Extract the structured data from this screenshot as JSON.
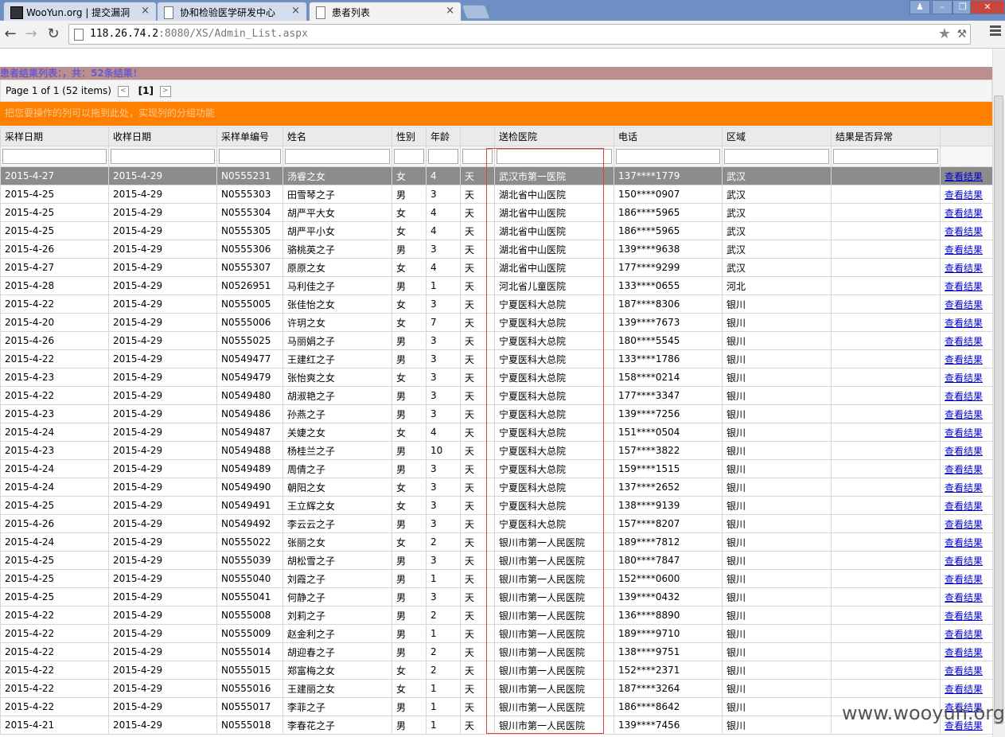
{
  "browser": {
    "tabs": [
      {
        "label": "WooYun.org | 提交漏洞",
        "active": false
      },
      {
        "label": "协和检验医学研发中心",
        "active": false
      },
      {
        "label": "患者列表",
        "active": true
      }
    ],
    "url_host": "118.26.74.2",
    "url_rest": ":8080/XS/Admin_List.aspx"
  },
  "page": {
    "caption": "患者结果列表：，共：52条结果！",
    "pager": {
      "text": "Page 1 of 1 (52 items)",
      "prev": "<",
      "current": "[1]",
      "next": ">"
    },
    "notice": "把您要操作的列可以拖到此处，实现列的分组功能",
    "columns": [
      "采样日期",
      "收样日期",
      "采样单编号",
      "姓名",
      "性别",
      "年龄",
      "",
      "送检医院",
      "电话",
      "区域",
      "结果是否异常",
      ""
    ],
    "rows": [
      [
        "2015-4-27",
        "2015-4-29",
        "N0555231",
        "汤睿之女",
        "女",
        "4",
        "天",
        "武汉市第一医院",
        "137****1779",
        "武汉",
        "",
        "查看结果"
      ],
      [
        "2015-4-25",
        "2015-4-29",
        "N0555303",
        "田雪琴之子",
        "男",
        "3",
        "天",
        "湖北省中山医院",
        "150****0907",
        "武汉",
        "",
        "查看结果"
      ],
      [
        "2015-4-25",
        "2015-4-29",
        "N0555304",
        "胡严平大女",
        "女",
        "4",
        "天",
        "湖北省中山医院",
        "186****5965",
        "武汉",
        "",
        "查看结果"
      ],
      [
        "2015-4-25",
        "2015-4-29",
        "N0555305",
        "胡严平小女",
        "女",
        "4",
        "天",
        "湖北省中山医院",
        "186****5965",
        "武汉",
        "",
        "查看结果"
      ],
      [
        "2015-4-26",
        "2015-4-29",
        "N0555306",
        "骆桃英之子",
        "男",
        "3",
        "天",
        "湖北省中山医院",
        "139****9638",
        "武汉",
        "",
        "查看结果"
      ],
      [
        "2015-4-27",
        "2015-4-29",
        "N0555307",
        "原原之女",
        "女",
        "4",
        "天",
        "湖北省中山医院",
        "177****9299",
        "武汉",
        "",
        "查看结果"
      ],
      [
        "2015-4-28",
        "2015-4-29",
        "N0526951",
        "马利佳之子",
        "男",
        "1",
        "天",
        "河北省儿童医院",
        "133****0655",
        "河北",
        "",
        "查看结果"
      ],
      [
        "2015-4-22",
        "2015-4-29",
        "N0555005",
        "张佳怡之女",
        "女",
        "3",
        "天",
        "宁夏医科大总院",
        "187****8306",
        "银川",
        "",
        "查看结果"
      ],
      [
        "2015-4-20",
        "2015-4-29",
        "N0555006",
        "许玥之女",
        "女",
        "7",
        "天",
        "宁夏医科大总院",
        "139****7673",
        "银川",
        "",
        "查看结果"
      ],
      [
        "2015-4-26",
        "2015-4-29",
        "N0555025",
        "马丽娟之子",
        "男",
        "3",
        "天",
        "宁夏医科大总院",
        "180****5545",
        "银川",
        "",
        "查看结果"
      ],
      [
        "2015-4-22",
        "2015-4-29",
        "N0549477",
        "王建红之子",
        "男",
        "3",
        "天",
        "宁夏医科大总院",
        "133****1786",
        "银川",
        "",
        "查看结果"
      ],
      [
        "2015-4-23",
        "2015-4-29",
        "N0549479",
        "张怡爽之女",
        "女",
        "3",
        "天",
        "宁夏医科大总院",
        "158****0214",
        "银川",
        "",
        "查看结果"
      ],
      [
        "2015-4-22",
        "2015-4-29",
        "N0549480",
        "胡淑艳之子",
        "男",
        "3",
        "天",
        "宁夏医科大总院",
        "177****3347",
        "银川",
        "",
        "查看结果"
      ],
      [
        "2015-4-23",
        "2015-4-29",
        "N0549486",
        "孙燕之子",
        "男",
        "3",
        "天",
        "宁夏医科大总院",
        "139****7256",
        "银川",
        "",
        "查看结果"
      ],
      [
        "2015-4-24",
        "2015-4-29",
        "N0549487",
        "关婕之女",
        "女",
        "4",
        "天",
        "宁夏医科大总院",
        "151****0504",
        "银川",
        "",
        "查看结果"
      ],
      [
        "2015-4-23",
        "2015-4-29",
        "N0549488",
        "杨桂兰之子",
        "男",
        "10",
        "天",
        "宁夏医科大总院",
        "157****3822",
        "银川",
        "",
        "查看结果"
      ],
      [
        "2015-4-24",
        "2015-4-29",
        "N0549489",
        "周倩之子",
        "男",
        "3",
        "天",
        "宁夏医科大总院",
        "159****1515",
        "银川",
        "",
        "查看结果"
      ],
      [
        "2015-4-24",
        "2015-4-29",
        "N0549490",
        "朝阳之女",
        "女",
        "3",
        "天",
        "宁夏医科大总院",
        "137****2652",
        "银川",
        "",
        "查看结果"
      ],
      [
        "2015-4-25",
        "2015-4-29",
        "N0549491",
        "王立辉之女",
        "女",
        "3",
        "天",
        "宁夏医科大总院",
        "138****9139",
        "银川",
        "",
        "查看结果"
      ],
      [
        "2015-4-26",
        "2015-4-29",
        "N0549492",
        "李云云之子",
        "男",
        "3",
        "天",
        "宁夏医科大总院",
        "157****8207",
        "银川",
        "",
        "查看结果"
      ],
      [
        "2015-4-24",
        "2015-4-29",
        "N0555022",
        "张丽之女",
        "女",
        "2",
        "天",
        "银川市第一人民医院",
        "189****7812",
        "银川",
        "",
        "查看结果"
      ],
      [
        "2015-4-25",
        "2015-4-29",
        "N0555039",
        "胡松雪之子",
        "男",
        "3",
        "天",
        "银川市第一人民医院",
        "180****7847",
        "银川",
        "",
        "查看结果"
      ],
      [
        "2015-4-25",
        "2015-4-29",
        "N0555040",
        "刘霞之子",
        "男",
        "1",
        "天",
        "银川市第一人民医院",
        "152****0600",
        "银川",
        "",
        "查看结果"
      ],
      [
        "2015-4-25",
        "2015-4-29",
        "N0555041",
        "何静之子",
        "男",
        "3",
        "天",
        "银川市第一人民医院",
        "139****0432",
        "银川",
        "",
        "查看结果"
      ],
      [
        "2015-4-22",
        "2015-4-29",
        "N0555008",
        "刘莉之子",
        "男",
        "2",
        "天",
        "银川市第一人民医院",
        "136****8890",
        "银川",
        "",
        "查看结果"
      ],
      [
        "2015-4-22",
        "2015-4-29",
        "N0555009",
        "赵金利之子",
        "男",
        "1",
        "天",
        "银川市第一人民医院",
        "189****9710",
        "银川",
        "",
        "查看结果"
      ],
      [
        "2015-4-22",
        "2015-4-29",
        "N0555014",
        "胡迎春之子",
        "男",
        "2",
        "天",
        "银川市第一人民医院",
        "138****9751",
        "银川",
        "",
        "查看结果"
      ],
      [
        "2015-4-22",
        "2015-4-29",
        "N0555015",
        "郑富梅之女",
        "女",
        "2",
        "天",
        "银川市第一人民医院",
        "152****2371",
        "银川",
        "",
        "查看结果"
      ],
      [
        "2015-4-22",
        "2015-4-29",
        "N0555016",
        "王建丽之女",
        "女",
        "1",
        "天",
        "银川市第一人民医院",
        "187****3264",
        "银川",
        "",
        "查看结果"
      ],
      [
        "2015-4-22",
        "2015-4-29",
        "N0555017",
        "李菲之子",
        "男",
        "1",
        "天",
        "银川市第一人民医院",
        "186****8642",
        "银川",
        "",
        "查看结果"
      ],
      [
        "2015-4-21",
        "2015-4-29",
        "N0555018",
        "李春花之子",
        "男",
        "1",
        "天",
        "银川市第一人民医院",
        "139****7456",
        "银川",
        "",
        "查看结果"
      ]
    ]
  },
  "watermark": "www.wooyun.org"
}
